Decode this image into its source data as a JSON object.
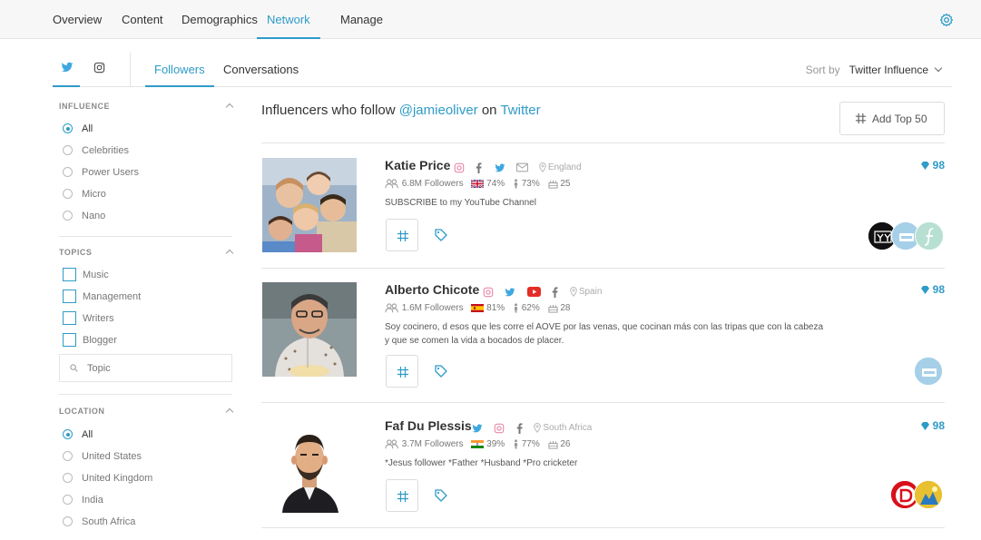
{
  "topnav": {
    "tabs": [
      {
        "label": "Overview"
      },
      {
        "label": "Content"
      },
      {
        "label": "Demographics"
      },
      {
        "label": "Network"
      },
      {
        "label": "Manage"
      }
    ],
    "active": "Network"
  },
  "subnav": {
    "networks": [
      "twitter-icon",
      "instagram-icon"
    ],
    "tabs": [
      {
        "label": "Followers"
      },
      {
        "label": "Conversations"
      }
    ],
    "sort_label": "Sort by",
    "sort_value": "Twitter Influence"
  },
  "sidebar": {
    "influence": {
      "title": "INFLUENCE",
      "options": [
        "All",
        "Celebrities",
        "Power Users",
        "Micro",
        "Nano"
      ],
      "selected": "All"
    },
    "topics": {
      "title": "TOPICS",
      "options": [
        "Music",
        "Management",
        "Writers",
        "Blogger"
      ],
      "search_placeholder": "Topic"
    },
    "location": {
      "title": "LOCATION",
      "options": [
        "All",
        "United States",
        "United Kingdom",
        "India",
        "South Africa"
      ],
      "selected": "All"
    }
  },
  "main": {
    "title_prefix": "Influencers who follow",
    "handle": "@jamieoliver",
    "title_on": "on",
    "network": "Twitter",
    "add_button": "Add Top 50"
  },
  "colors": {
    "accent": "#2f9bc7",
    "twitter": "#3fa8e0",
    "instagram": "#e1306c",
    "youtube": "#e52d27"
  },
  "influencers": [
    {
      "name": "Katie Price",
      "socials": [
        "instagram-icon",
        "facebook-icon",
        "twitter-icon",
        "email-icon"
      ],
      "location": "England",
      "followers": "6.8M Followers",
      "country_flag": "uk-flag-icon",
      "country_pct": "74%",
      "gender_pct": "73%",
      "age": "25",
      "bio": "SUBSCRIBE to my YouTube Channel",
      "score": "98"
    },
    {
      "name": "Alberto Chicote",
      "socials": [
        "instagram-icon",
        "twitter-icon",
        "youtube-icon",
        "facebook-icon"
      ],
      "location": "Spain",
      "followers": "1.6M Followers",
      "country_flag": "spain-flag-icon",
      "country_pct": "81%",
      "gender_pct": "62%",
      "age": "28",
      "bio": "Soy cocinero, d esos que les corre el AOVE por las venas, que cocinan más con las tripas que con la cabeza y que se comen la vida a bocados de placer.",
      "score": "98"
    },
    {
      "name": "Faf Du Plessis",
      "socials": [
        "twitter-icon",
        "instagram-icon",
        "facebook-icon"
      ],
      "location": "South Africa",
      "followers": "3.7M Followers",
      "country_flag": "india-flag-icon",
      "country_pct": "39%",
      "gender_pct": "77%",
      "age": "26",
      "bio": "*Jesus follower *Father *Husband *Pro cricketer",
      "score": "98"
    }
  ]
}
